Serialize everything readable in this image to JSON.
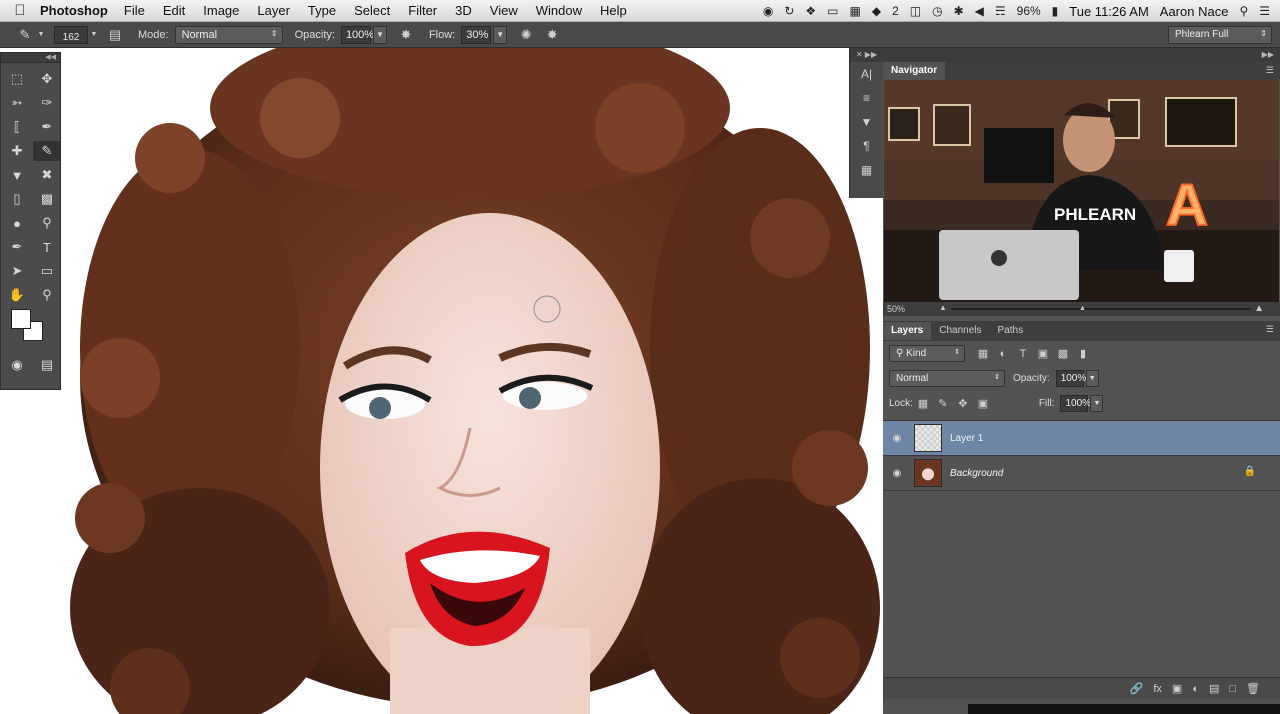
{
  "menubar": {
    "apple_icon": "apple-icon",
    "app_name": "Photoshop",
    "menus": [
      "File",
      "Edit",
      "Image",
      "Layer",
      "Type",
      "Select",
      "Filter",
      "3D",
      "View",
      "Window",
      "Help"
    ],
    "status_icons": [
      "creative-cloud-icon",
      "sync-icon",
      "dropbox-icon",
      "display-icon",
      "grid-icon",
      "evernote-icon"
    ],
    "badge": "2",
    "battery": "96%",
    "clock": "Tue 11:26 AM",
    "user": "Aaron Nace"
  },
  "options": {
    "brush_size": "162",
    "mode_label": "Mode:",
    "mode_value": "Normal",
    "opacity_label": "Opacity:",
    "opacity_value": "100%",
    "flow_label": "Flow:",
    "flow_value": "30%",
    "workspace": "Phlearn Full"
  },
  "navigator": {
    "tab": "Navigator",
    "zoom": "50%",
    "shirt_text": "PHLEARN",
    "sign_letter": "A"
  },
  "layers_panel": {
    "tabs": [
      "Layers",
      "Channels",
      "Paths"
    ],
    "kind_label": "Kind",
    "blend_mode": "Normal",
    "opacity_label": "Opacity:",
    "opacity_value": "100%",
    "lock_label": "Lock:",
    "fill_label": "Fill:",
    "fill_value": "100%",
    "layers": [
      {
        "name": "Layer 1",
        "selected": true
      },
      {
        "name": "Background",
        "selected": false,
        "locked": true
      }
    ]
  },
  "colors": {
    "accent_selected_layer": "#6f85a6",
    "panel_bg": "#535353",
    "lip_red": "#d8141f",
    "hair_brown": "#6b3520"
  }
}
